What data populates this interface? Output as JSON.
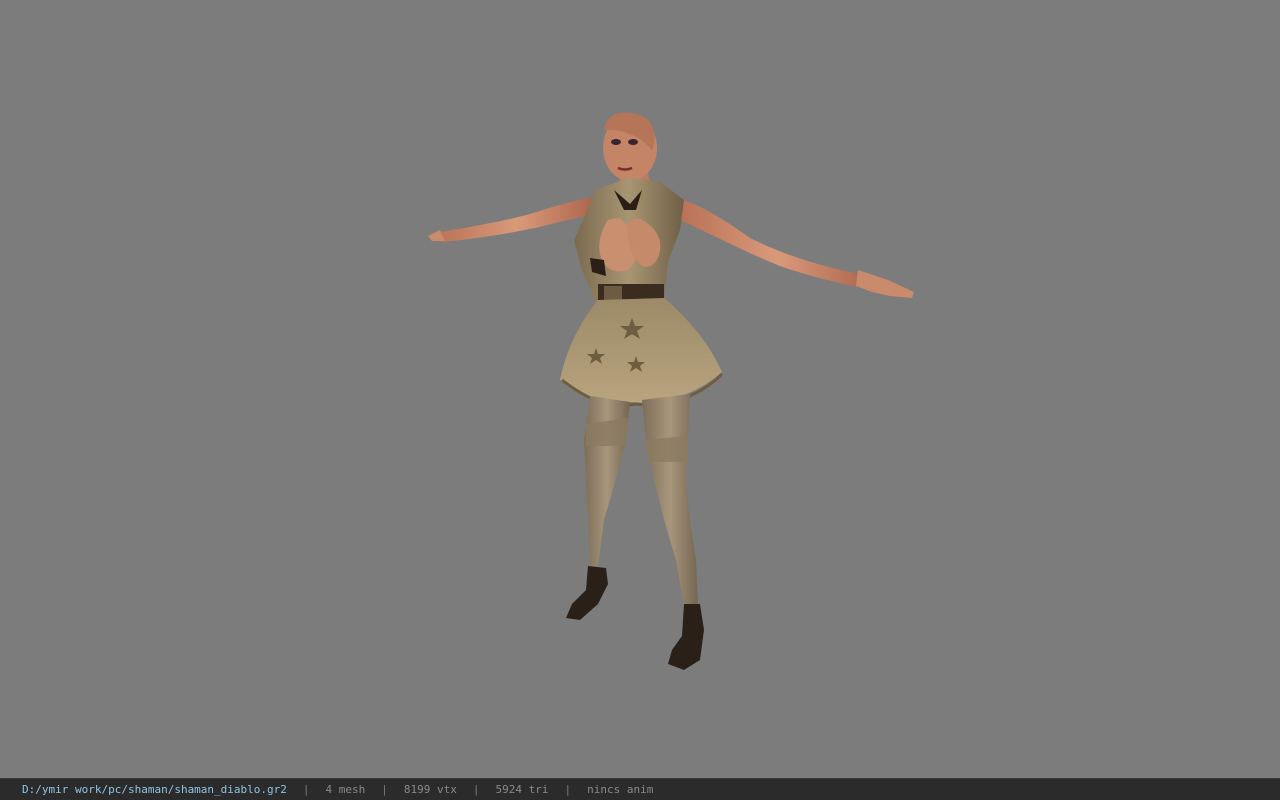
{
  "viewer": {
    "background_color": "#7c7c7c",
    "model_description": "character-model-tpose"
  },
  "status_bar": {
    "file_path": "D:/ymir work/pc/shaman/shaman_diablo.gr2",
    "mesh_count": "4 mesh",
    "vertex_count": "8199 vtx",
    "triangle_count": "5924 tri",
    "animation": "nincs anim",
    "separator": "|",
    "path_color": "#8fc3e6",
    "text_color": "#8a8a8a"
  }
}
